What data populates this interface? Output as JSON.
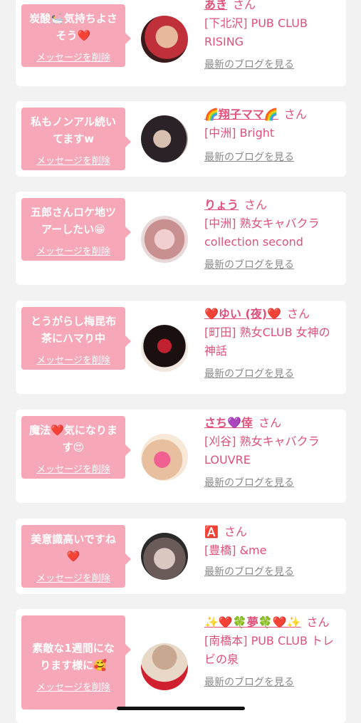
{
  "delete_label": "メッセージを削除",
  "blog_label": "最新のブログを見る",
  "san_label": "さん",
  "cards": [
    {
      "message": "炭酸🛀気持ちよさそう❤️",
      "name": "あき",
      "shop": "[下北沢] PUB CLUB RISING"
    },
    {
      "message": "私もノンアル続いてますw",
      "name": "🌈翔子ママ🌈",
      "shop": "[中洲] Bright"
    },
    {
      "message": "五郎さんロケ地ツアーしたい😁",
      "name": "りょう",
      "shop": "[中洲] 熟女キャバクラ collection second"
    },
    {
      "message": "とうがらし梅昆布茶にハマり中",
      "name": "❤️ゆい (夜)❤️",
      "shop": "[町田] 熟女CLUB 女神の神話"
    },
    {
      "message": "魔法❤️気になります😍",
      "name": "さち💜倖",
      "shop": "[刈谷] 熟女キャバクラ LOUVRE"
    },
    {
      "message": "美意識高いですね❤️",
      "name": "🅰️",
      "shop": "[豊橋] &me"
    },
    {
      "message": "素敵な1週間になります様に🥰",
      "name": "✨❤️🍀夢🍀❤️✨",
      "shop": "[南橋本] PUB CLUB トレビの泉"
    }
  ]
}
